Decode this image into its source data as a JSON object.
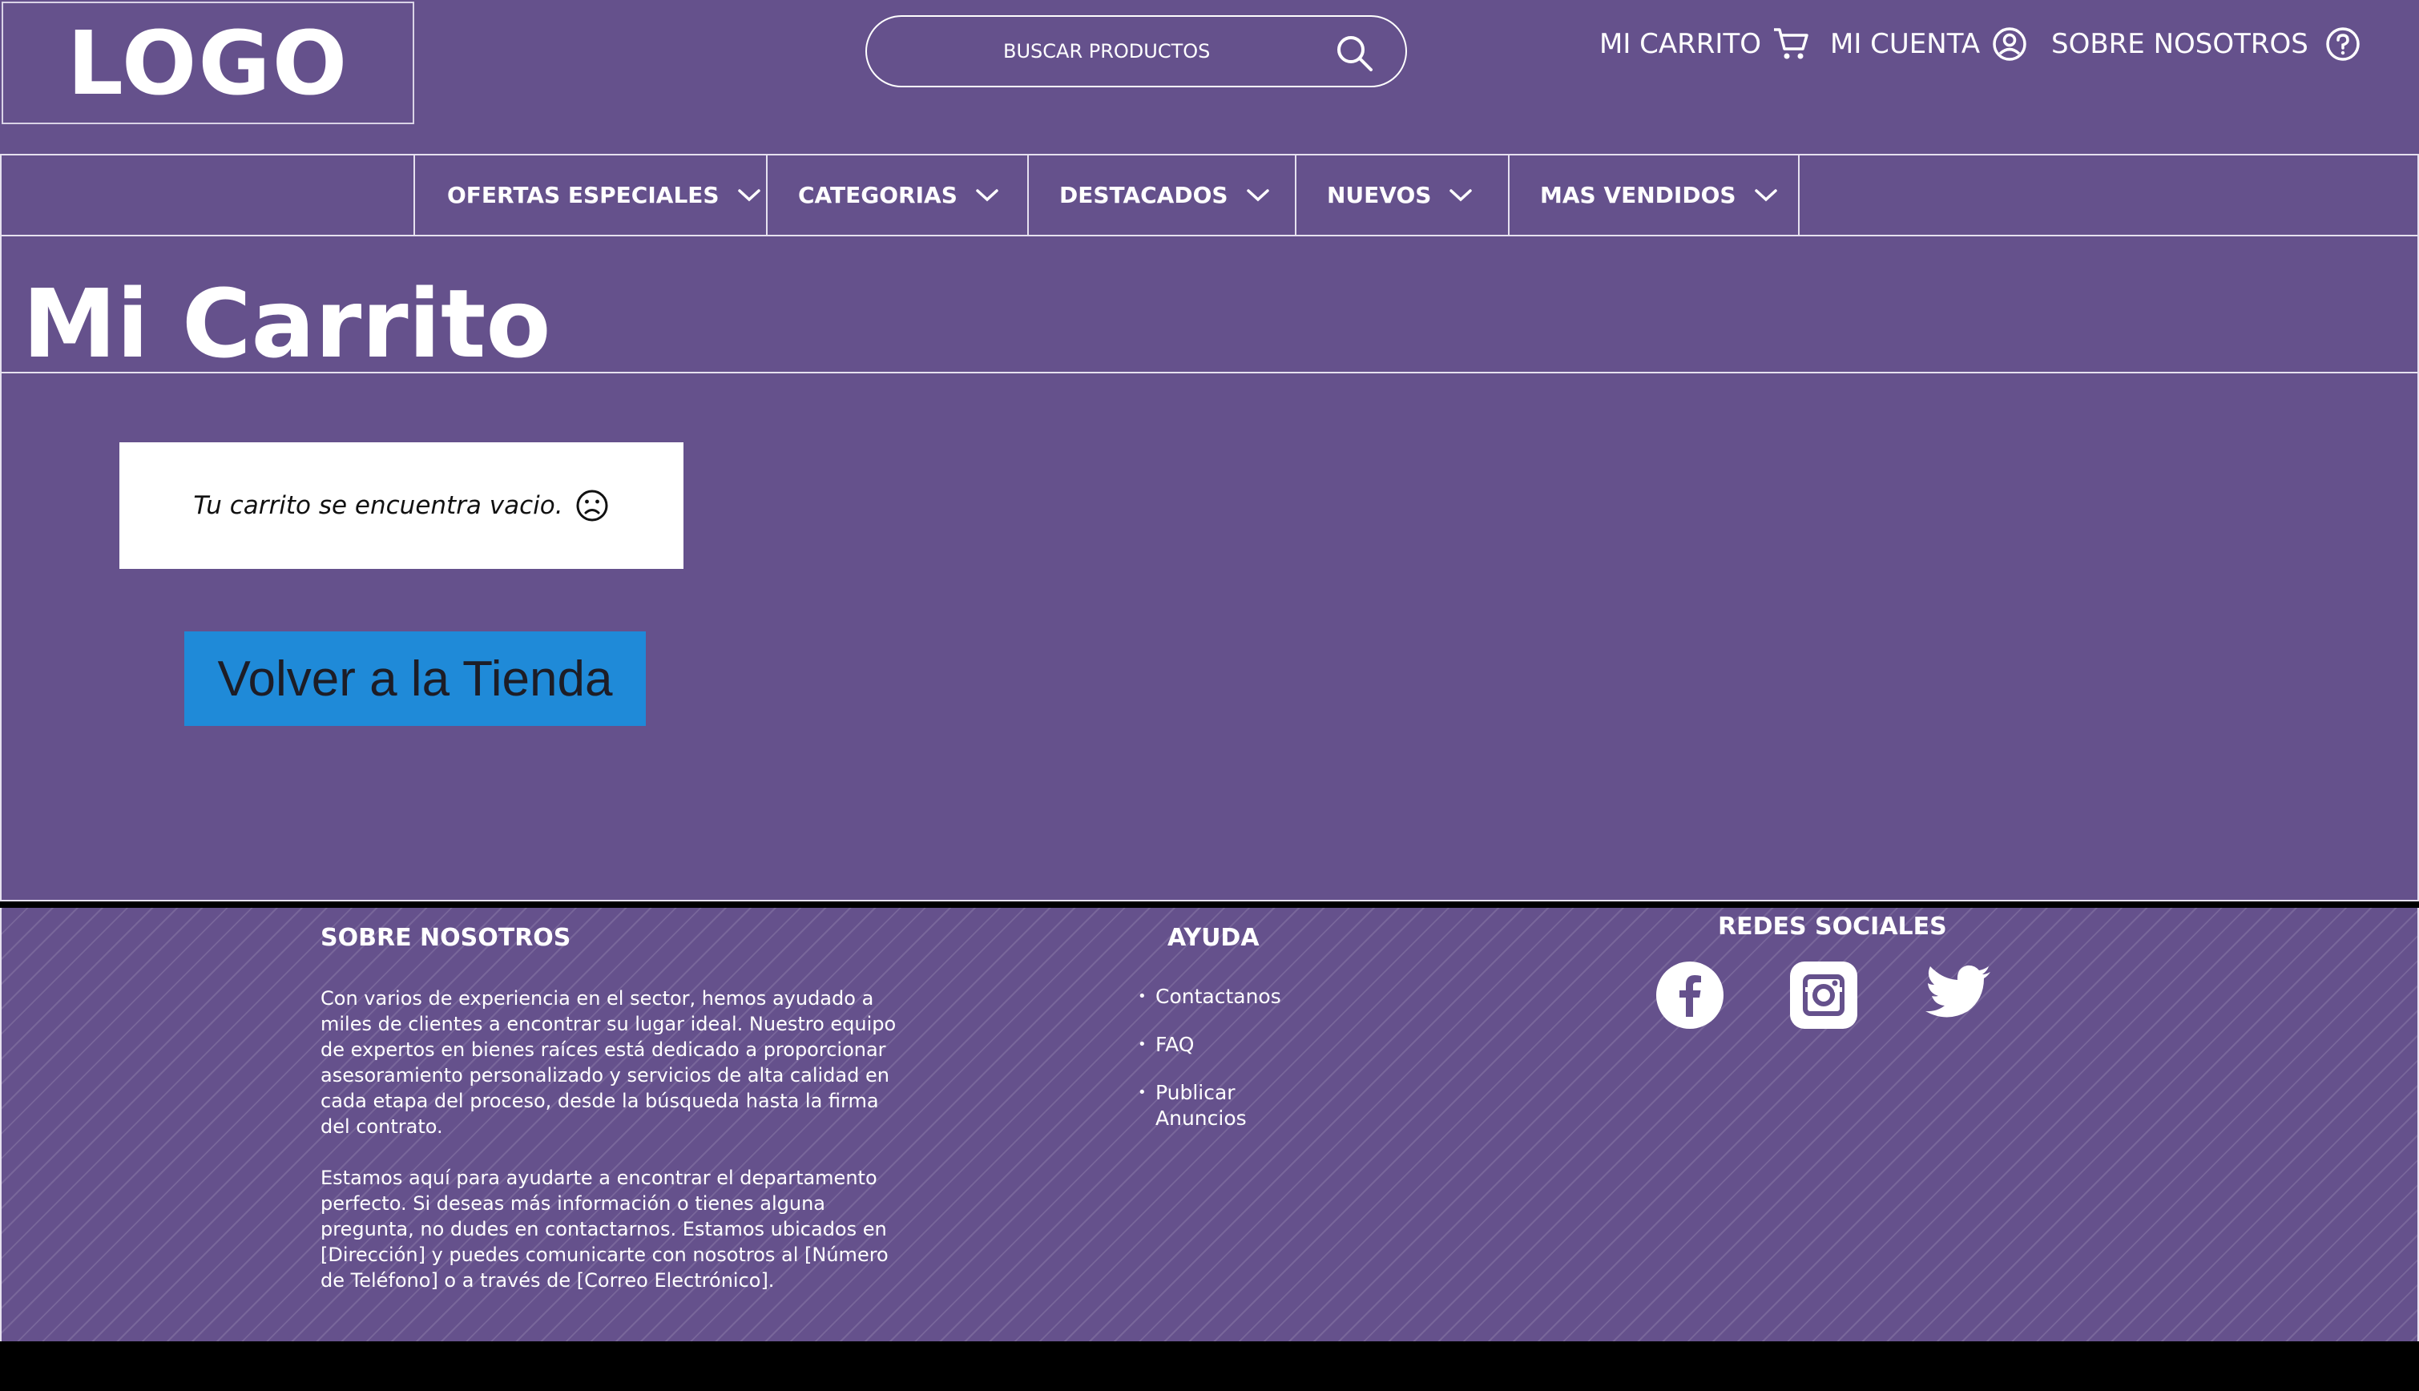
{
  "header": {
    "logo": "LOGO",
    "search": {
      "placeholder": "BUSCAR PRODUCTOS"
    },
    "nav": {
      "cart": "MI CARRITO",
      "account": "MI CUENTA",
      "about": "SOBRE NOSOTROS"
    }
  },
  "categories": [
    {
      "label": "OFERTAS ESPECIALES"
    },
    {
      "label": "CATEGORIAS"
    },
    {
      "label": "DESTACADOS"
    },
    {
      "label": "NUEVOS"
    },
    {
      "label": "MAS VENDIDOS"
    }
  ],
  "main": {
    "title": "Mi Carrito",
    "empty_message": "Tu carrito se encuentra vacio.",
    "back_button": "Volver a la Tienda"
  },
  "footer": {
    "about": {
      "heading": "SOBRE NOSOTROS",
      "paragraph1": "Con varios de experiencia en el sector, hemos ayudado a miles de clientes a encontrar su lugar ideal. Nuestro equipo de expertos en bienes raíces está dedicado a proporcionar asesoramiento personalizado y servicios de alta calidad en cada etapa del proceso, desde la búsqueda hasta la firma del contrato.",
      "paragraph2": "Estamos aquí para ayudarte a encontrar el departamento perfecto. Si deseas más información o tienes alguna pregunta, no dudes en contactarnos. Estamos ubicados en [Dirección] y puedes comunicarte con nosotros al [Número de Teléfono] o a través de [Correo Electrónico]."
    },
    "help": {
      "heading": "AYUDA",
      "links": [
        "Contactanos",
        "FAQ",
        "Publicar Anuncios"
      ]
    },
    "social": {
      "heading": "REDES SOCIALES",
      "icons": [
        "facebook-icon",
        "instagram-icon",
        "twitter-icon"
      ]
    }
  },
  "colors": {
    "background": "#65518c",
    "button": "#1f8ad8",
    "border": "#e6e1ef"
  }
}
